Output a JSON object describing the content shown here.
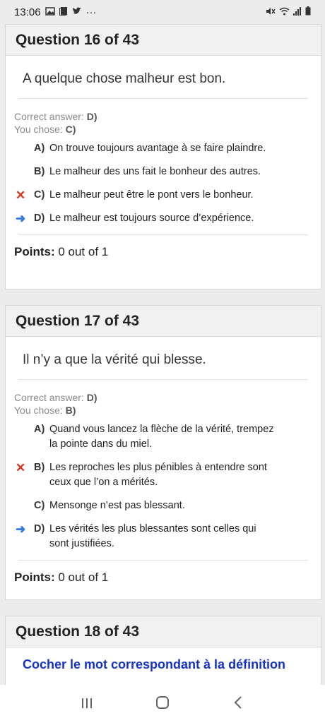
{
  "status_bar": {
    "time": "13:06",
    "overflow": "···"
  },
  "questions": [
    {
      "title": "Question 16 of 43",
      "text": "A quelque chose malheur est bon.",
      "correct_label": "Correct answer:",
      "correct_value": "D)",
      "chose_label": "You chose:",
      "chose_value": "C)",
      "answers": [
        {
          "letter": "A)",
          "text": "On trouve toujours avantage à se faire plaindre.",
          "mark": ""
        },
        {
          "letter": "B)",
          "text": "Le malheur des uns fait le bonheur des autres.",
          "mark": ""
        },
        {
          "letter": "C)",
          "text": "Le malheur peut être le pont vers le bonheur.",
          "mark": "wrong"
        },
        {
          "letter": "D)",
          "text": "Le malheur est toujours source d’expérience.",
          "mark": "correct"
        }
      ],
      "points_label": "Points:",
      "points_value": "0 out of 1"
    },
    {
      "title": "Question 17 of 43",
      "text": "Il n’y a que la vérité qui blesse.",
      "correct_label": "Correct answer:",
      "correct_value": "D)",
      "chose_label": "You chose:",
      "chose_value": "B)",
      "answers": [
        {
          "letter": "A)",
          "text": "Quand vous lancez la flèche de la vérité, trempez la pointe dans du miel.",
          "mark": ""
        },
        {
          "letter": "B)",
          "text": "Les reproches les plus pénibles à entendre sont ceux que l’on a mérités.",
          "mark": "wrong"
        },
        {
          "letter": "C)",
          "text": "Mensonge n’est pas blessant.",
          "mark": ""
        },
        {
          "letter": "D)",
          "text": "Les vérités les plus blessantes sont celles qui sont justifiées.",
          "mark": "correct"
        }
      ],
      "points_label": "Points:",
      "points_value": "0 out of 1"
    },
    {
      "title": "Question 18 of 43",
      "text": "Cocher le mot correspondant à la définition"
    }
  ],
  "icons": {
    "wrong": "✕",
    "correct": "➜"
  },
  "colors": {
    "wrong": "#d9341e",
    "correct": "#2a7be4",
    "instruction": "#1532c8"
  }
}
